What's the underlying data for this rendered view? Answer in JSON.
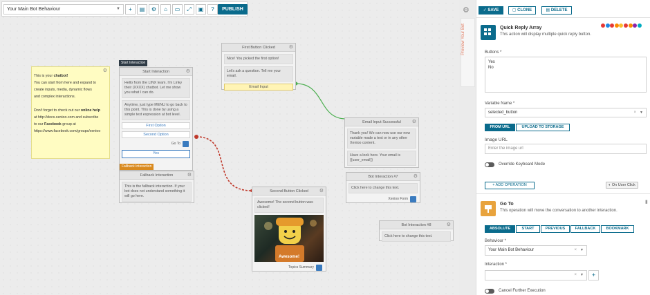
{
  "toolbar": {
    "behaviour_select": "Your Main Bot Behaviour",
    "publish_label": "PUBLISH"
  },
  "sticky": {
    "line1_pre": "This is your ",
    "line1_bold": "chatbot!",
    "line2": "You can start from here and expand to",
    "line3": "create inputs, media, dynamic flows",
    "line4": "and complex interactions.",
    "line5_pre": "Don't forget to check out our ",
    "line5_bold": "online help",
    "line6": "at http://docs.xenioo.com and subscribe",
    "line7_pre": "to our ",
    "line7_bold": "Facebook",
    "line7_post": " group at",
    "line8": "https://www.facebook.com/groups/xenioo"
  },
  "nodes": {
    "start": {
      "tag": "Start Interaction",
      "title": "Start Interaction",
      "msg1": "Hello from the LINX team. I'm Linky their (XXXX) chatbot. Let me show you what I can do.",
      "msg2": "Anytime, just type MENU to go back to this point. This is done by using a simple text expression at bot level.",
      "opt1": "First Option",
      "opt2": "Second Option",
      "goto": "Go To",
      "opt3": "Yes"
    },
    "fallback": {
      "tag": "Fallback Interaction",
      "title": "Fallback Interaction",
      "msg": "This is the fallback interaction. If your bot does not understand something it will go here."
    },
    "first": {
      "title": "First Button Clicked",
      "msg1": "Nice! You picked the first option!",
      "msg2": "Let's ask a question. Tell me your email.",
      "opt": "Email Input"
    },
    "email": {
      "title": "Email Input Successful",
      "msg1": "Thank you! We can now use our new variable made a text or in any other Xenioo content.",
      "msg2": "Have a look here. Your email is {{user_email}}"
    },
    "bot7": {
      "title": "Bot Interaction #7",
      "msg": "Click here to change this text.",
      "goto": "Xenioo Form"
    },
    "second": {
      "title": "Second Button Clicked",
      "msg": "Awesome! The second button was clicked!",
      "image_caption": "Awesome!",
      "goto": "Topics Summary"
    },
    "bot8": {
      "title": "Bot Interaction #8",
      "msg": "Click here to change this text."
    }
  },
  "preview_tab": "Preview Your Bot",
  "panel": {
    "save": "SAVE",
    "clone": "CLONE",
    "delete": "DELETE",
    "qra": {
      "title": "Quick Reply Array",
      "desc": "This action will display multiple quick reply button.",
      "buttons_label": "Buttons *",
      "buttons_value": [
        "Yes",
        "No"
      ],
      "variable_label": "Variable Name *",
      "variable_value": "selected_button",
      "tab_url": "FROM URL",
      "tab_upload": "UPLOAD TO STORAGE",
      "image_url_label": "Image URL",
      "image_url_placeholder": "Enter the image url",
      "override_label": "Override Keyboard Mode",
      "add_operation": "+ ADD OPERATION",
      "on_user_click": "On User Click"
    },
    "goto": {
      "title": "Go To",
      "desc": "This operation will move the conversation to another interaction.",
      "tabs": [
        "ABSOLUTE",
        "START",
        "PREVIOUS",
        "FALLBACK",
        "BOOKMARK"
      ],
      "behaviour_label": "Behaviour *",
      "behaviour_value": "Your Main Bot Behaviour",
      "interaction_label": "Interaction *",
      "cancel_label": "Cancel Further Execution"
    }
  },
  "colors": {
    "accent": "#0a6b8c",
    "sticky": "#fffcc2",
    "green_link": "#4caf50",
    "red_link": "#c0392b",
    "start_tag": "#2f3b46",
    "fallback_tag": "#d98a1f",
    "preview_text": "#e07a5f",
    "qra_icon": "#0a6b8c",
    "goto_icon": "#e8a33d"
  },
  "channel_icons": [
    "youtube-icon",
    "telegram-icon",
    "messenger-icon",
    "chat-icon",
    "sms-icon",
    "slack-icon",
    "web-icon",
    "phone-icon",
    "alexa-icon"
  ]
}
